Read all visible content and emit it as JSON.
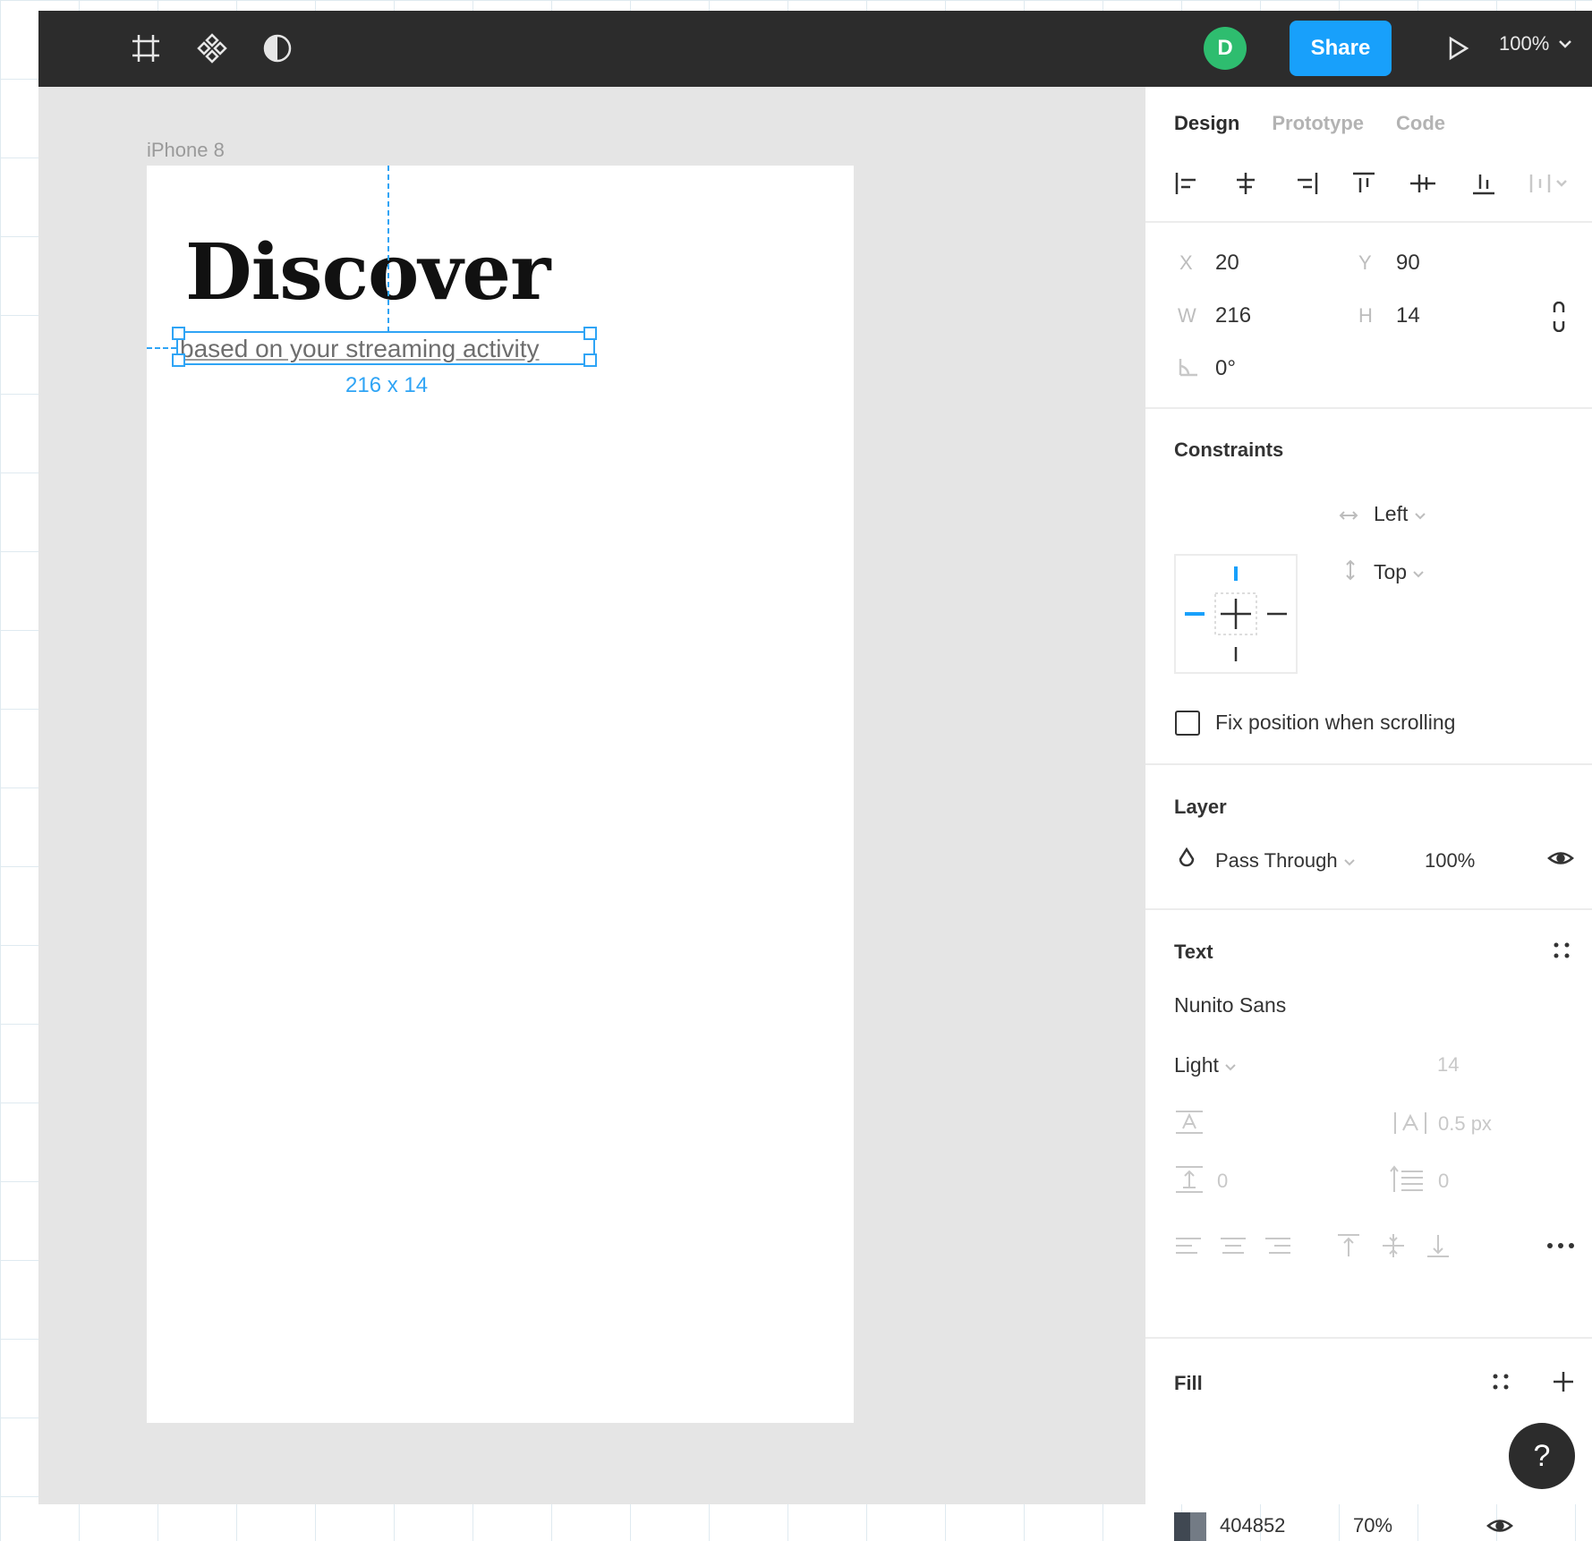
{
  "toolbar": {
    "icons": [
      "frame-icon",
      "component-icon",
      "contrast-icon"
    ],
    "avatar_initial": "D",
    "share_label": "Share",
    "zoom_value": "100%"
  },
  "canvas": {
    "frame_label": "iPhone 8",
    "heading": "Discover",
    "subtitle": "based on your streaming activity",
    "selection_size": "216 x 14"
  },
  "panel": {
    "tabs": [
      "Design",
      "Prototype",
      "Code"
    ],
    "position": {
      "x_label": "X",
      "x_value": "20",
      "y_label": "Y",
      "y_value": "90",
      "w_label": "W",
      "w_value": "216",
      "h_label": "H",
      "h_value": "14",
      "rotation_value": "0°"
    },
    "constraints": {
      "title": "Constraints",
      "horizontal": "Left",
      "vertical": "Top",
      "fix_label": "Fix position when scrolling"
    },
    "layer": {
      "title": "Layer",
      "blend": "Pass Through",
      "opacity": "100%"
    },
    "text": {
      "title": "Text",
      "font_family": "Nunito Sans",
      "font_weight": "Light",
      "font_size": "14",
      "letter_spacing": "0.5 px",
      "line_height": "0",
      "paragraph_spacing": "0"
    },
    "fill": {
      "title": "Fill",
      "hex": "404852",
      "opacity": "70%",
      "color": "#404852"
    }
  },
  "help_label": "?"
}
